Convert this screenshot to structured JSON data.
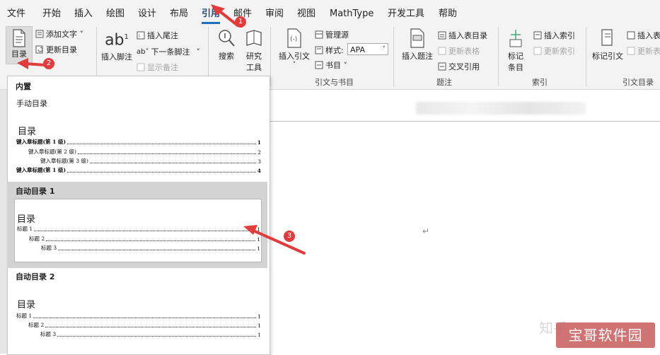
{
  "menu": {
    "items": [
      "文件",
      "开始",
      "插入",
      "绘图",
      "设计",
      "布局",
      "引用",
      "邮件",
      "审阅",
      "视图",
      "MathType",
      "开发工具",
      "帮助"
    ],
    "active_index": 6
  },
  "ribbon": {
    "toc": {
      "label": "目录",
      "add_text": "添加文字 ˅",
      "update": "更新目录"
    },
    "footnotes": {
      "insert_footnote": "插入脚注",
      "ab_glyph": "ab",
      "sup": "1",
      "insert_endnote": "插入尾注",
      "next_footnote": "下一条脚注",
      "show_notes": "显示备注"
    },
    "research": {
      "search": "搜索",
      "research_tools_1": "研究",
      "research_tools_2": "工具"
    },
    "citations": {
      "insert_citation": "插入引文",
      "manage_sources": "管理源",
      "style_label": "样式:",
      "style_value": "APA",
      "bibliography": "书目 ˅",
      "group_label": "引文与书目"
    },
    "captions": {
      "insert_caption": "插入题注",
      "insert_table_of_figures": "插入表目录",
      "update_table": "更新表格",
      "cross_reference": "交叉引用",
      "group_label": "题注"
    },
    "index": {
      "mark_entry_1": "标记",
      "mark_entry_2": "条目",
      "insert_index": "插入索引",
      "update_index": "更新索引",
      "group_label": "索引"
    },
    "toa": {
      "mark_citation": "标记引文",
      "insert_toa": "插入表",
      "update_toa": "更新表",
      "group_label": "引文目录"
    }
  },
  "dropdown": {
    "builtin": "内置",
    "manual": "手动目录",
    "manual_preview": {
      "title": "目录",
      "lines": [
        {
          "text": "键入章标题(第 1 级)",
          "page": "1",
          "bold": true
        },
        {
          "text": "键入章标题(第 2 级)",
          "page": "2",
          "bold": false
        },
        {
          "text": "键入章标题(第 3 级)",
          "page": "3",
          "bold": false
        },
        {
          "text": "键入章标题(第 1 级)",
          "page": "4",
          "bold": true
        }
      ]
    },
    "auto1": {
      "label": "自动目录 1",
      "title": "目录",
      "lines": [
        {
          "text": "标题 1",
          "page": "1"
        },
        {
          "text": "标题 2",
          "page": "1"
        },
        {
          "text": "标题 3",
          "page": "1"
        }
      ]
    },
    "auto2": {
      "label": "自动目录 2",
      "title": "目录",
      "lines": [
        {
          "text": "标题 1",
          "page": "1"
        },
        {
          "text": "标题 2",
          "page": "1"
        },
        {
          "text": "标题 3",
          "page": "1"
        }
      ]
    }
  },
  "document": {
    "paragraph_mark": "↵"
  },
  "annotations": [
    "1",
    "2",
    "3"
  ],
  "watermark": {
    "zhihu": "知乎",
    "site": "宝哥软件园"
  },
  "colors": {
    "accent": "#1f6fc0",
    "arrow": "#e23b3b"
  }
}
